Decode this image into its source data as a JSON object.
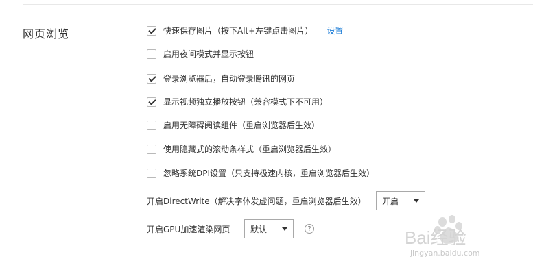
{
  "section": {
    "title": "网页浏览"
  },
  "options": [
    {
      "label": "快速保存图片（按下Alt+左键点击图片）",
      "checked": true,
      "link": "设置"
    },
    {
      "label": "启用夜间模式并显示按钮",
      "checked": false
    },
    {
      "label": "登录浏览器后，自动登录腾讯的网页",
      "checked": true
    },
    {
      "label": "显示视频独立播放按钮（兼容模式下不可用）",
      "checked": true
    },
    {
      "label": "启用无障碍阅读组件（重启浏览器后生效）",
      "checked": false
    },
    {
      "label": "使用隐藏式的滚动条样式（重启浏览器后生效）",
      "checked": false
    },
    {
      "label": "忽略系统DPI设置（只支持极速内核，重启浏览器后生效）",
      "checked": false
    }
  ],
  "directwrite": {
    "label": "开启DirectWrite（解决字体发虚问题，重启浏览器后生效）",
    "value": "开启"
  },
  "gpu": {
    "label": "开启GPU加速渲染网页",
    "value": "默认",
    "help": "?"
  },
  "watermark": {
    "logo": "Bai经验",
    "url": "jingyan.baidu.com"
  }
}
